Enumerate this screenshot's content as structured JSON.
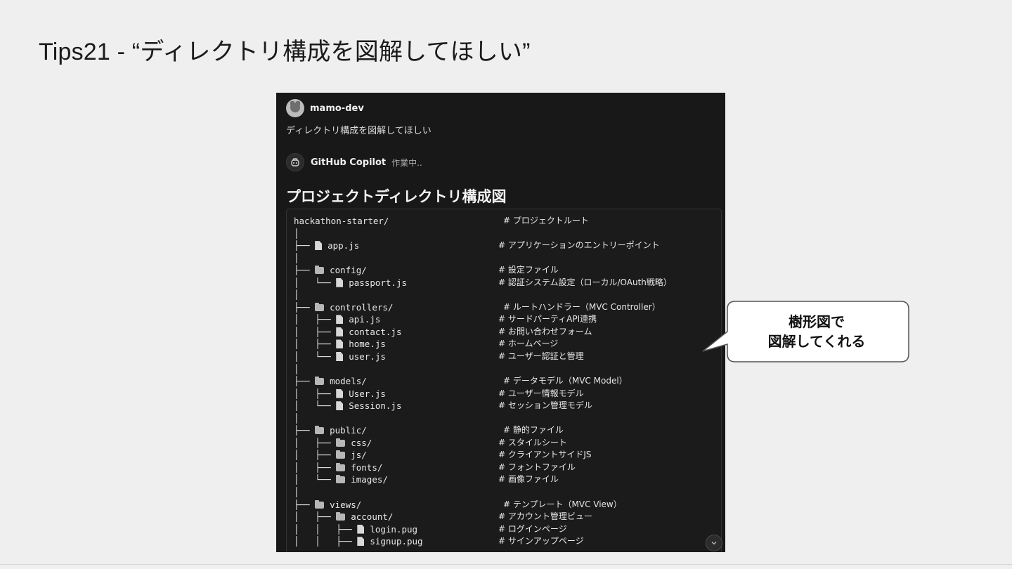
{
  "slide": {
    "title": "Tips21 - “ディレクトリ構成を図解してほしい”"
  },
  "chat": {
    "user_name": "mamo-dev",
    "user_message": "ディレクトリ構成を図解してほしい",
    "assistant_name": "GitHub Copilot",
    "assistant_status": "作業中..",
    "heading": "プロジェクトディレクトリ構成図",
    "tree": [
      {
        "prefix": "hackathon-starter/",
        "icon": "",
        "name": "",
        "comment": "# プロジェクトルート",
        "indent": 1
      },
      {
        "prefix": "│",
        "icon": "",
        "name": "",
        "comment": "",
        "indent": 0
      },
      {
        "prefix": "├── ",
        "icon": "file",
        "name": "app.js",
        "comment": "# アプリケーションのエントリーポイント",
        "indent": 0
      },
      {
        "prefix": "│",
        "icon": "",
        "name": "",
        "comment": "",
        "indent": 0
      },
      {
        "prefix": "├── ",
        "icon": "folder",
        "name": "config/",
        "comment": "# 設定ファイル",
        "indent": 0
      },
      {
        "prefix": "│   └── ",
        "icon": "file",
        "name": "passport.js",
        "comment": "# 認証システム設定（ローカル/OAuth戦略）",
        "indent": 0
      },
      {
        "prefix": "│",
        "icon": "",
        "name": "",
        "comment": "",
        "indent": 0
      },
      {
        "prefix": "├── ",
        "icon": "folder",
        "name": "controllers/",
        "comment": "# ルートハンドラー（MVC Controller）",
        "indent": 1
      },
      {
        "prefix": "│   ├── ",
        "icon": "file",
        "name": "api.js",
        "comment": "# サードパーティAPI連携",
        "indent": 0
      },
      {
        "prefix": "│   ├── ",
        "icon": "file",
        "name": "contact.js",
        "comment": "# お問い合わせフォーム",
        "indent": 0
      },
      {
        "prefix": "│   ├── ",
        "icon": "file",
        "name": "home.js",
        "comment": "# ホームページ",
        "indent": 0
      },
      {
        "prefix": "│   └── ",
        "icon": "file",
        "name": "user.js",
        "comment": "# ユーザー認証と管理",
        "indent": 0
      },
      {
        "prefix": "│",
        "icon": "",
        "name": "",
        "comment": "",
        "indent": 0
      },
      {
        "prefix": "├── ",
        "icon": "folder",
        "name": "models/",
        "comment": "# データモデル（MVC Model）",
        "indent": 1
      },
      {
        "prefix": "│   ├── ",
        "icon": "file",
        "name": "User.js",
        "comment": "# ユーザー情報モデル",
        "indent": 0
      },
      {
        "prefix": "│   └── ",
        "icon": "file",
        "name": "Session.js",
        "comment": "# セッション管理モデル",
        "indent": 0
      },
      {
        "prefix": "│",
        "icon": "",
        "name": "",
        "comment": "",
        "indent": 0
      },
      {
        "prefix": "├── ",
        "icon": "folder",
        "name": "public/",
        "comment": "# 静的ファイル",
        "indent": 1
      },
      {
        "prefix": "│   ├── ",
        "icon": "folder",
        "name": "css/",
        "comment": "# スタイルシート",
        "indent": 0
      },
      {
        "prefix": "│   ├── ",
        "icon": "folder",
        "name": "js/",
        "comment": "# クライアントサイドJS",
        "indent": 0
      },
      {
        "prefix": "│   ├── ",
        "icon": "folder",
        "name": "fonts/",
        "comment": "# フォントファイル",
        "indent": 0
      },
      {
        "prefix": "│   └── ",
        "icon": "folder",
        "name": "images/",
        "comment": "# 画像ファイル",
        "indent": 0
      },
      {
        "prefix": "│",
        "icon": "",
        "name": "",
        "comment": "",
        "indent": 0
      },
      {
        "prefix": "├── ",
        "icon": "folder",
        "name": "views/",
        "comment": "# テンプレート（MVC View）",
        "indent": 1
      },
      {
        "prefix": "│   ├── ",
        "icon": "folder",
        "name": "account/",
        "comment": "# アカウント管理ビュー",
        "indent": 0
      },
      {
        "prefix": "│   │   ├── ",
        "icon": "file",
        "name": "login.pug",
        "comment": "# ログインページ",
        "indent": 0
      },
      {
        "prefix": "│   │   ├── ",
        "icon": "file",
        "name": "signup.pug",
        "comment": "# サインアップページ",
        "indent": 0
      }
    ]
  },
  "callout": {
    "line1": "樹形図で",
    "line2": "図解してくれる"
  }
}
